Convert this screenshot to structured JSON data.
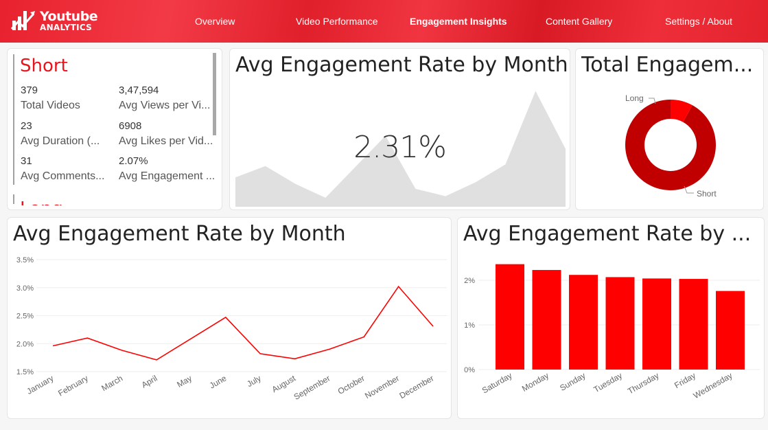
{
  "header": {
    "logo_line1": "Youtube",
    "logo_line2": "ANALYTICS",
    "nav": [
      "Overview",
      "Video Performance",
      "Engagement Insights",
      "Content Gallery",
      "Settings / About"
    ],
    "active_index": 2
  },
  "kpi": {
    "section_title": "Short",
    "items": [
      {
        "value": "379",
        "label": "Total Videos"
      },
      {
        "value": "3,47,594",
        "label": "Avg Views per Vi..."
      },
      {
        "value": "23",
        "label": "Avg Duration (..."
      },
      {
        "value": "6908",
        "label": "Avg Likes per Vid..."
      },
      {
        "value": "31",
        "label": "Avg Comments..."
      },
      {
        "value": "2.07%",
        "label": "Avg Engagement ..."
      }
    ],
    "next_section_title": "Long"
  },
  "area_card": {
    "title": "Avg Engagement Rate by Month",
    "value": "2.31%"
  },
  "donut_card": {
    "title": "Total Engagem...",
    "labels": [
      "Long",
      "Short"
    ]
  },
  "line_card": {
    "title": "Avg Engagement Rate by Month"
  },
  "bar_card": {
    "title": "Avg Engagement Rate by ..."
  },
  "colors": {
    "accent": "#ff0000",
    "donut_short": "#c00000",
    "donut_long": "#ff0000",
    "area_fill": "#e0e0e0"
  },
  "chart_data": [
    {
      "type": "area",
      "categories": [
        "January",
        "February",
        "March",
        "April",
        "May",
        "June",
        "July",
        "August",
        "September",
        "October",
        "November",
        "December"
      ],
      "values": [
        1.96,
        2.1,
        1.88,
        1.71,
        2.09,
        2.47,
        1.82,
        1.73,
        1.9,
        2.12,
        3.02,
        2.31
      ],
      "title": "Avg Engagement Rate by Month",
      "ylim": [
        1.6,
        3.1
      ],
      "grid": false
    },
    {
      "type": "pie",
      "labels": [
        "Long",
        "Short"
      ],
      "values": [
        8,
        92
      ],
      "title": "Total Engagem..."
    },
    {
      "type": "line",
      "categories": [
        "January",
        "February",
        "March",
        "April",
        "May",
        "June",
        "July",
        "August",
        "September",
        "October",
        "November",
        "December"
      ],
      "values": [
        1.96,
        2.1,
        1.88,
        1.71,
        2.09,
        2.47,
        1.82,
        1.73,
        1.9,
        2.12,
        3.02,
        2.31
      ],
      "title": "Avg Engagement Rate by Month",
      "yticks": [
        "1.5%",
        "2.0%",
        "2.5%",
        "3.0%",
        "3.5%"
      ],
      "ylim": [
        1.5,
        3.5
      ],
      "grid": true
    },
    {
      "type": "bar",
      "categories": [
        "Saturday",
        "Monday",
        "Sunday",
        "Tuesday",
        "Thursday",
        "Friday",
        "Wednesday"
      ],
      "values": [
        2.36,
        2.23,
        2.12,
        2.07,
        2.04,
        2.03,
        1.76
      ],
      "title": "Avg Engagement Rate by ...",
      "yticks": [
        "0%",
        "1%",
        "2%"
      ],
      "ylim": [
        0,
        2.4
      ],
      "grid": true
    }
  ]
}
